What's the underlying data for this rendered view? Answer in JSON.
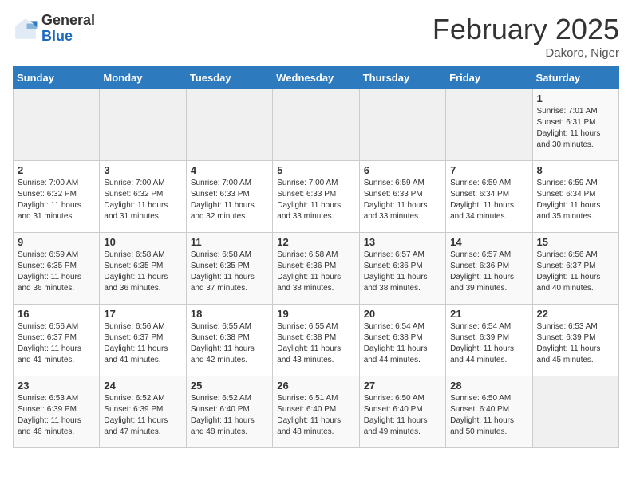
{
  "header": {
    "logo_general": "General",
    "logo_blue": "Blue",
    "title": "February 2025",
    "subtitle": "Dakoro, Niger"
  },
  "days_of_week": [
    "Sunday",
    "Monday",
    "Tuesday",
    "Wednesday",
    "Thursday",
    "Friday",
    "Saturday"
  ],
  "weeks": [
    [
      {
        "day": "",
        "info": ""
      },
      {
        "day": "",
        "info": ""
      },
      {
        "day": "",
        "info": ""
      },
      {
        "day": "",
        "info": ""
      },
      {
        "day": "",
        "info": ""
      },
      {
        "day": "",
        "info": ""
      },
      {
        "day": "1",
        "info": "Sunrise: 7:01 AM\nSunset: 6:31 PM\nDaylight: 11 hours\nand 30 minutes."
      }
    ],
    [
      {
        "day": "2",
        "info": "Sunrise: 7:00 AM\nSunset: 6:32 PM\nDaylight: 11 hours\nand 31 minutes."
      },
      {
        "day": "3",
        "info": "Sunrise: 7:00 AM\nSunset: 6:32 PM\nDaylight: 11 hours\nand 31 minutes."
      },
      {
        "day": "4",
        "info": "Sunrise: 7:00 AM\nSunset: 6:33 PM\nDaylight: 11 hours\nand 32 minutes."
      },
      {
        "day": "5",
        "info": "Sunrise: 7:00 AM\nSunset: 6:33 PM\nDaylight: 11 hours\nand 33 minutes."
      },
      {
        "day": "6",
        "info": "Sunrise: 6:59 AM\nSunset: 6:33 PM\nDaylight: 11 hours\nand 33 minutes."
      },
      {
        "day": "7",
        "info": "Sunrise: 6:59 AM\nSunset: 6:34 PM\nDaylight: 11 hours\nand 34 minutes."
      },
      {
        "day": "8",
        "info": "Sunrise: 6:59 AM\nSunset: 6:34 PM\nDaylight: 11 hours\nand 35 minutes."
      }
    ],
    [
      {
        "day": "9",
        "info": "Sunrise: 6:59 AM\nSunset: 6:35 PM\nDaylight: 11 hours\nand 36 minutes."
      },
      {
        "day": "10",
        "info": "Sunrise: 6:58 AM\nSunset: 6:35 PM\nDaylight: 11 hours\nand 36 minutes."
      },
      {
        "day": "11",
        "info": "Sunrise: 6:58 AM\nSunset: 6:35 PM\nDaylight: 11 hours\nand 37 minutes."
      },
      {
        "day": "12",
        "info": "Sunrise: 6:58 AM\nSunset: 6:36 PM\nDaylight: 11 hours\nand 38 minutes."
      },
      {
        "day": "13",
        "info": "Sunrise: 6:57 AM\nSunset: 6:36 PM\nDaylight: 11 hours\nand 38 minutes."
      },
      {
        "day": "14",
        "info": "Sunrise: 6:57 AM\nSunset: 6:36 PM\nDaylight: 11 hours\nand 39 minutes."
      },
      {
        "day": "15",
        "info": "Sunrise: 6:56 AM\nSunset: 6:37 PM\nDaylight: 11 hours\nand 40 minutes."
      }
    ],
    [
      {
        "day": "16",
        "info": "Sunrise: 6:56 AM\nSunset: 6:37 PM\nDaylight: 11 hours\nand 41 minutes."
      },
      {
        "day": "17",
        "info": "Sunrise: 6:56 AM\nSunset: 6:37 PM\nDaylight: 11 hours\nand 41 minutes."
      },
      {
        "day": "18",
        "info": "Sunrise: 6:55 AM\nSunset: 6:38 PM\nDaylight: 11 hours\nand 42 minutes."
      },
      {
        "day": "19",
        "info": "Sunrise: 6:55 AM\nSunset: 6:38 PM\nDaylight: 11 hours\nand 43 minutes."
      },
      {
        "day": "20",
        "info": "Sunrise: 6:54 AM\nSunset: 6:38 PM\nDaylight: 11 hours\nand 44 minutes."
      },
      {
        "day": "21",
        "info": "Sunrise: 6:54 AM\nSunset: 6:39 PM\nDaylight: 11 hours\nand 44 minutes."
      },
      {
        "day": "22",
        "info": "Sunrise: 6:53 AM\nSunset: 6:39 PM\nDaylight: 11 hours\nand 45 minutes."
      }
    ],
    [
      {
        "day": "23",
        "info": "Sunrise: 6:53 AM\nSunset: 6:39 PM\nDaylight: 11 hours\nand 46 minutes."
      },
      {
        "day": "24",
        "info": "Sunrise: 6:52 AM\nSunset: 6:39 PM\nDaylight: 11 hours\nand 47 minutes."
      },
      {
        "day": "25",
        "info": "Sunrise: 6:52 AM\nSunset: 6:40 PM\nDaylight: 11 hours\nand 48 minutes."
      },
      {
        "day": "26",
        "info": "Sunrise: 6:51 AM\nSunset: 6:40 PM\nDaylight: 11 hours\nand 48 minutes."
      },
      {
        "day": "27",
        "info": "Sunrise: 6:50 AM\nSunset: 6:40 PM\nDaylight: 11 hours\nand 49 minutes."
      },
      {
        "day": "28",
        "info": "Sunrise: 6:50 AM\nSunset: 6:40 PM\nDaylight: 11 hours\nand 50 minutes."
      },
      {
        "day": "",
        "info": ""
      }
    ]
  ]
}
